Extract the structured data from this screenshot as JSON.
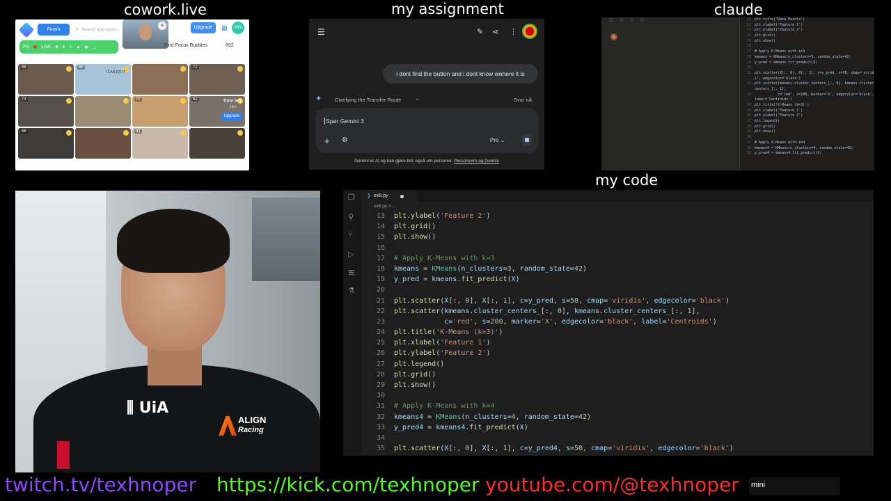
{
  "labels": {
    "cowork": "cowork.live",
    "assignment": "my assignment",
    "claude": "claude",
    "code": "my code"
  },
  "cowork": {
    "finish": "Finish",
    "search_placeholder": "Search app users...",
    "upgrade": "Upgrade",
    "avatar": "PG",
    "live_user": "PG",
    "live": "LIVE",
    "find_buddies": "Find Focus Buddies",
    "count": "692",
    "tiles": [
      {
        "n": "88",
        "color": "#6b5a4e"
      },
      {
        "n": "66",
        "color": "#a8c4d8",
        "extra": "I CAN DO IT"
      },
      {
        "n": "",
        "color": "#8a6f55"
      },
      {
        "n": "72",
        "color": "#6e5f55"
      },
      {
        "n": "73",
        "color": "#55504a"
      },
      {
        "n": "",
        "color": "#9a8c74"
      },
      {
        "n": "70",
        "color": "#c8a070"
      },
      {
        "n": "52",
        "color": "#7a7068",
        "time": "Time left",
        "time_sub": "18m",
        "up": "Upgrade"
      },
      {
        "n": "68",
        "color": "#3e3a38"
      },
      {
        "n": "",
        "color": "#6a5040"
      },
      {
        "n": "41",
        "color": "#c8b8a8"
      },
      {
        "n": "",
        "color": "#4a403a"
      }
    ]
  },
  "gemini": {
    "message": "i dont find the button and i dont know wehere it is",
    "status": "Clarifying the Transfer Route",
    "svar": "Svar nå",
    "placeholder": "Spør Gemini 3",
    "model": "Pro",
    "disclaimer": "Gemini er AI og kan gjøre feil, også om personer. ",
    "disclaimer_link": "Personvern og Gemini"
  },
  "claude": {
    "lines": [
      {
        "n": "11",
        "t": "plt.title('Data Points')"
      },
      {
        "n": "12",
        "t": "plt.xlabel('Feature 1')"
      },
      {
        "n": "13",
        "t": "plt.ylabel('Feature 2')"
      },
      {
        "n": "14",
        "t": "plt.grid()"
      },
      {
        "n": "15",
        "t": "plt.show()"
      },
      {
        "n": "16",
        "t": ""
      },
      {
        "n": "17",
        "t": "# Apply K-Means with k=3"
      },
      {
        "n": "18",
        "t": "kmeans = KMeans(n_clusters=3, random_state=42)"
      },
      {
        "n": "19",
        "t": "y_pred = kmeans.fit_predict(X)"
      },
      {
        "n": "20",
        "t": ""
      },
      {
        "n": "21",
        "t": "plt.scatter(X[:, 0], X[:, 1], c=y_pred, s=50, cmap='viridi"
      },
      {
        "n": "",
        "t": "s', edgecolor='black')"
      },
      {
        "n": "22",
        "t": "plt.scatter(kmeans.cluster_centers_[:, 0], kmeans.cluster_"
      },
      {
        "n": "",
        "t": "centers_[:, 1],"
      },
      {
        "n": "23",
        "t": "           c='red', s=200, marker='X', edgecolor='black',"
      },
      {
        "n": "",
        "t": "label='Centroids')"
      },
      {
        "n": "24",
        "t": "plt.title('K-Means (k=3)')"
      },
      {
        "n": "25",
        "t": "plt.xlabel('Feature 1')"
      },
      {
        "n": "26",
        "t": "plt.ylabel('Feature 2')"
      },
      {
        "n": "27",
        "t": "plt.legend()"
      },
      {
        "n": "28",
        "t": "plt.grid()"
      },
      {
        "n": "29",
        "t": "plt.show()"
      },
      {
        "n": "30",
        "t": ""
      },
      {
        "n": "31",
        "t": "# Apply K-Means with k=4"
      },
      {
        "n": "32",
        "t": "kmeans4 = KMeans(n_clusters=4, random_state=42)"
      },
      {
        "n": "33",
        "t": "y_pred4 = kmeans4.fit_predict(X)"
      }
    ]
  },
  "vscode": {
    "tab": "ex8.py",
    "breadcrumb": "ex8.py > ...",
    "lines": [
      {
        "n": "13",
        "tokens": [
          [
            "fn",
            "plt.ylabel"
          ],
          [
            "op",
            "("
          ],
          [
            "str",
            "'Feature 2'"
          ],
          [
            "op",
            ")"
          ]
        ]
      },
      {
        "n": "14",
        "tokens": [
          [
            "fn",
            "plt.grid"
          ],
          [
            "op",
            "()"
          ]
        ]
      },
      {
        "n": "15",
        "tokens": [
          [
            "fn",
            "plt.show"
          ],
          [
            "op",
            "()"
          ]
        ]
      },
      {
        "n": "16",
        "tokens": []
      },
      {
        "n": "17",
        "tokens": [
          [
            "com",
            "# Apply K-Means with k=3"
          ]
        ]
      },
      {
        "n": "18",
        "tokens": [
          [
            "var",
            "kmeans"
          ],
          [
            "op",
            " = "
          ],
          [
            "cls",
            "KMeans"
          ],
          [
            "op",
            "("
          ],
          [
            "var",
            "n_clusters"
          ],
          [
            "op",
            "="
          ],
          [
            "num",
            "3"
          ],
          [
            "op",
            ", "
          ],
          [
            "var",
            "random_state"
          ],
          [
            "op",
            "="
          ],
          [
            "num",
            "42"
          ],
          [
            "op",
            ")"
          ]
        ]
      },
      {
        "n": "19",
        "tokens": [
          [
            "var",
            "y_pred"
          ],
          [
            "op",
            " = "
          ],
          [
            "var",
            "kmeans"
          ],
          [
            "op",
            "."
          ],
          [
            "fn",
            "fit_predict"
          ],
          [
            "op",
            "("
          ],
          [
            "var",
            "X"
          ],
          [
            "op",
            ")"
          ]
        ]
      },
      {
        "n": "20",
        "tokens": []
      },
      {
        "n": "21",
        "tokens": [
          [
            "fn",
            "plt.scatter"
          ],
          [
            "op",
            "("
          ],
          [
            "var",
            "X"
          ],
          [
            "op",
            "[:, "
          ],
          [
            "num",
            "0"
          ],
          [
            "op",
            "], "
          ],
          [
            "var",
            "X"
          ],
          [
            "op",
            "[:, "
          ],
          [
            "num",
            "1"
          ],
          [
            "op",
            "], "
          ],
          [
            "var",
            "c"
          ],
          [
            "op",
            "="
          ],
          [
            "var",
            "y_pred"
          ],
          [
            "op",
            ", "
          ],
          [
            "var",
            "s"
          ],
          [
            "op",
            "="
          ],
          [
            "num",
            "50"
          ],
          [
            "op",
            ", "
          ],
          [
            "var",
            "cmap"
          ],
          [
            "op",
            "="
          ],
          [
            "str",
            "'viridis'"
          ],
          [
            "op",
            ", "
          ],
          [
            "var",
            "edgecolor"
          ],
          [
            "op",
            "="
          ],
          [
            "str",
            "'black'"
          ],
          [
            "op",
            ")"
          ]
        ]
      },
      {
        "n": "22",
        "tokens": [
          [
            "fn",
            "plt.scatter"
          ],
          [
            "op",
            "("
          ],
          [
            "var",
            "kmeans"
          ],
          [
            "op",
            "."
          ],
          [
            "var",
            "cluster_centers_"
          ],
          [
            "op",
            "[:, "
          ],
          [
            "num",
            "0"
          ],
          [
            "op",
            "], "
          ],
          [
            "var",
            "kmeans"
          ],
          [
            "op",
            "."
          ],
          [
            "var",
            "cluster_centers_"
          ],
          [
            "op",
            "[:, "
          ],
          [
            "num",
            "1"
          ],
          [
            "op",
            "],"
          ]
        ]
      },
      {
        "n": "23",
        "tokens": [
          [
            "op",
            "            "
          ],
          [
            "var",
            "c"
          ],
          [
            "op",
            "="
          ],
          [
            "str",
            "'red'"
          ],
          [
            "op",
            ", "
          ],
          [
            "var",
            "s"
          ],
          [
            "op",
            "="
          ],
          [
            "num",
            "200"
          ],
          [
            "op",
            ", "
          ],
          [
            "var",
            "marker"
          ],
          [
            "op",
            "="
          ],
          [
            "str",
            "'X'"
          ],
          [
            "op",
            ", "
          ],
          [
            "var",
            "edgecolor"
          ],
          [
            "op",
            "="
          ],
          [
            "str",
            "'black'"
          ],
          [
            "op",
            ", "
          ],
          [
            "var",
            "label"
          ],
          [
            "op",
            "="
          ],
          [
            "str",
            "'Centroids'"
          ],
          [
            "op",
            ")"
          ]
        ]
      },
      {
        "n": "24",
        "tokens": [
          [
            "fn",
            "plt.title"
          ],
          [
            "op",
            "("
          ],
          [
            "str",
            "'K-Means (k=3)'"
          ],
          [
            "op",
            ")"
          ]
        ]
      },
      {
        "n": "25",
        "tokens": [
          [
            "fn",
            "plt.xlabel"
          ],
          [
            "op",
            "("
          ],
          [
            "str",
            "'Feature 1'"
          ],
          [
            "op",
            ")"
          ]
        ]
      },
      {
        "n": "26",
        "tokens": [
          [
            "fn",
            "plt.ylabel"
          ],
          [
            "op",
            "("
          ],
          [
            "str",
            "'Feature 2'"
          ],
          [
            "op",
            ")"
          ]
        ]
      },
      {
        "n": "27",
        "tokens": [
          [
            "fn",
            "plt.legend"
          ],
          [
            "op",
            "()"
          ]
        ]
      },
      {
        "n": "28",
        "tokens": [
          [
            "fn",
            "plt.grid"
          ],
          [
            "op",
            "()"
          ]
        ]
      },
      {
        "n": "29",
        "tokens": [
          [
            "fn",
            "plt.show"
          ],
          [
            "op",
            "()"
          ]
        ]
      },
      {
        "n": "30",
        "tokens": []
      },
      {
        "n": "31",
        "tokens": [
          [
            "com",
            "# Apply K-Means with k=4"
          ]
        ]
      },
      {
        "n": "32",
        "tokens": [
          [
            "var",
            "kmeans4"
          ],
          [
            "op",
            " = "
          ],
          [
            "cls",
            "KMeans"
          ],
          [
            "op",
            "("
          ],
          [
            "var",
            "n_clusters"
          ],
          [
            "op",
            "="
          ],
          [
            "num",
            "4"
          ],
          [
            "op",
            ", "
          ],
          [
            "var",
            "random_state"
          ],
          [
            "op",
            "="
          ],
          [
            "num",
            "42"
          ],
          [
            "op",
            ")"
          ]
        ]
      },
      {
        "n": "33",
        "tokens": [
          [
            "var",
            "y_pred4"
          ],
          [
            "op",
            " = "
          ],
          [
            "var",
            "kmeans4"
          ],
          [
            "op",
            "."
          ],
          [
            "fn",
            "fit_predict"
          ],
          [
            "op",
            "("
          ],
          [
            "var",
            "X"
          ],
          [
            "op",
            ")"
          ]
        ]
      },
      {
        "n": "34",
        "tokens": []
      },
      {
        "n": "35",
        "tokens": [
          [
            "fn",
            "plt.scatter"
          ],
          [
            "op",
            "("
          ],
          [
            "var",
            "X"
          ],
          [
            "op",
            "[:, "
          ],
          [
            "num",
            "0"
          ],
          [
            "op",
            "], "
          ],
          [
            "var",
            "X"
          ],
          [
            "op",
            "[:, "
          ],
          [
            "num",
            "1"
          ],
          [
            "op",
            "], "
          ],
          [
            "var",
            "c"
          ],
          [
            "op",
            "="
          ],
          [
            "var",
            "y_pred4"
          ],
          [
            "op",
            ", "
          ],
          [
            "var",
            "s"
          ],
          [
            "op",
            "="
          ],
          [
            "num",
            "50"
          ],
          [
            "op",
            ", "
          ],
          [
            "var",
            "cmap"
          ],
          [
            "op",
            "="
          ],
          [
            "str",
            "'viridis'"
          ],
          [
            "op",
            ", "
          ],
          [
            "var",
            "edgecolor"
          ],
          [
            "op",
            "="
          ],
          [
            "str",
            "'black'"
          ],
          [
            "op",
            ")"
          ]
        ]
      }
    ]
  },
  "webcam": {
    "shirt_logo_left": "UiA",
    "shirt_logo_right_1": "ALIGN",
    "shirt_logo_right_2": "Racing"
  },
  "footer": {
    "twitch": "twitch.tv/texhnoper",
    "kick": "https://kick.com/texhnoper",
    "youtube": "youtube.com/@texhnoper",
    "mini": "mini"
  },
  "colors": {
    "twitch": "#9146ff",
    "kick": "#53fc18",
    "youtube": "#ff2a2a"
  }
}
